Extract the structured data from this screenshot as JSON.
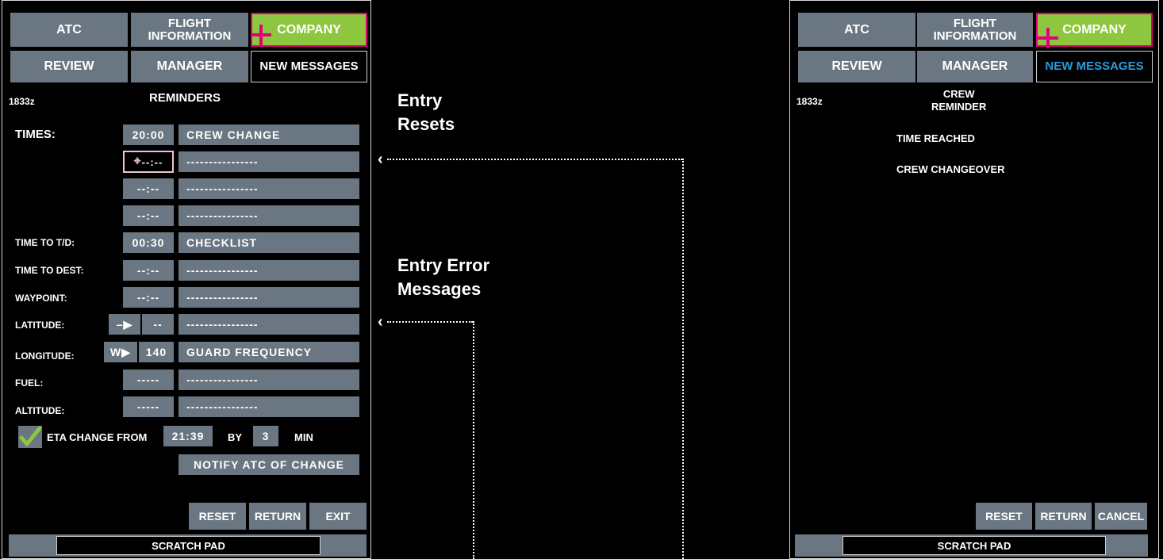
{
  "tabs": {
    "atc": "ATC",
    "flight_info": "FLIGHT\nINFORMATION",
    "company": "COMPANY",
    "review": "REVIEW",
    "manager": "MANAGER",
    "new_messages": "NEW MESSAGES"
  },
  "left": {
    "time": "1833z",
    "title": "REMINDERS",
    "rows": {
      "times_label": "TIMES:",
      "times": [
        {
          "time": "20:00",
          "text": "CREW CHANGE"
        },
        {
          "time": "--:--",
          "text": "----------------"
        },
        {
          "time": "--:--",
          "text": "----------------"
        },
        {
          "time": "--:--",
          "text": "----------------"
        }
      ],
      "ttd_label": "TIME TO T/D:",
      "ttd": {
        "time": "00:30",
        "text": "CHECKLIST"
      },
      "tdest_label": "TIME TO DEST:",
      "tdest": {
        "time": "--:--",
        "text": "----------------"
      },
      "wpt_label": "WAYPOINT:",
      "wpt": {
        "time": "--:--",
        "text": "----------------"
      },
      "lat_label": "LATITUDE:",
      "lat": {
        "dir": "–",
        "val": "--",
        "text": "----------------"
      },
      "lon_label": "LONGITUDE:",
      "lon": {
        "dir": "W",
        "val": "140",
        "text": "GUARD FREQUENCY"
      },
      "fuel_label": "FUEL:",
      "fuel": {
        "val": "-----",
        "text": "----------------"
      },
      "alt_label": "ALTITUDE:",
      "alt": {
        "val": "-----",
        "text": "----------------"
      }
    },
    "eta": {
      "label": "ETA CHANGE FROM",
      "time": "21:39",
      "by": "BY",
      "min_val": "3",
      "min": "MIN"
    },
    "notify": "NOTIFY ATC OF CHANGE",
    "buttons": {
      "reset": "RESET",
      "return": "RETURN",
      "exit": "EXIT"
    },
    "scratch": "SCRATCH PAD"
  },
  "annotations": {
    "entry_resets": "Entry\nResets",
    "entry_errors": "Entry Error\nMessages"
  },
  "right": {
    "time": "1833z",
    "title": "CREW\nREMINDER",
    "line1": "TIME REACHED",
    "line2": "CREW CHANGEOVER",
    "buttons": {
      "reset": "RESET",
      "return": "RETURN",
      "cancel": "CANCEL"
    },
    "scratch": "SCRATCH PAD"
  },
  "colors": {
    "tab_gray": "#6a7782",
    "company_green": "#8dc63f",
    "highlight_magenta": "#e3007e",
    "new_messages_blue": "#2b9bd8"
  }
}
